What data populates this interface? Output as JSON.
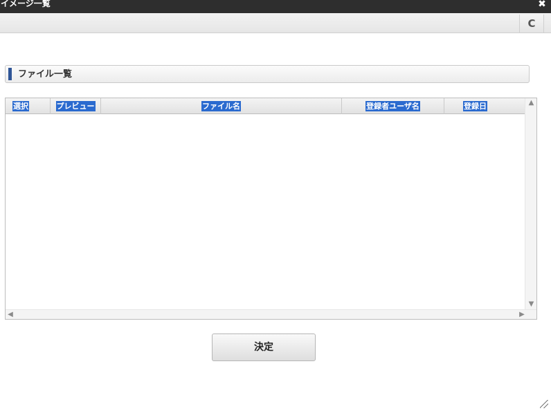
{
  "window": {
    "title": "イメージ一覧",
    "close_icon": "✖"
  },
  "toolbar": {
    "refresh_icon": "C"
  },
  "section": {
    "title": "ファイル一覧"
  },
  "table": {
    "columns": [
      {
        "key": "select",
        "label": "選択"
      },
      {
        "key": "preview",
        "label": "プレビュー"
      },
      {
        "key": "filename",
        "label": "ファイル名"
      },
      {
        "key": "user",
        "label": "登録者ユーザ名"
      },
      {
        "key": "date",
        "label": "登録日"
      }
    ],
    "rows": []
  },
  "scroll": {
    "up": "▲",
    "down": "▼",
    "left": "◀",
    "right": "▶"
  },
  "actions": {
    "decide_label": "決定"
  }
}
